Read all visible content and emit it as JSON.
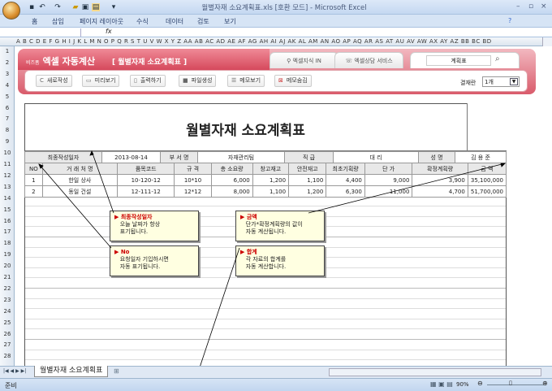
{
  "window": {
    "title": "월별자재 소요계획표.xls  [호환 모드] - Microsoft Excel"
  },
  "ribbon": {
    "tabs": [
      "홈",
      "삽입",
      "페이지 레이아웃",
      "수식",
      "데이터",
      "검토",
      "보기"
    ]
  },
  "formula": {
    "fx": "fx"
  },
  "columns": "A B C D E F G H I J K L M N O P Q R S T U V W X Y Z AA AB AC AD AE AF AG AH AI AJ AK AL AM AN AO AP AQ AR AS AT AU AV AW AX AY AZ BB BC BD",
  "rows": [
    "1",
    "2",
    "3",
    "4",
    "5",
    "6",
    "7",
    "8",
    "9",
    "10",
    "11",
    "12",
    "13",
    "14",
    "15",
    "16",
    "17",
    "18",
    "19",
    "20",
    "21",
    "22",
    "23",
    "24",
    "25",
    "26",
    "27",
    "28"
  ],
  "banner": {
    "brand_small": "비즈폼",
    "brand": "엑셀 자동계산",
    "subtitle": "[ 월별자재 소요계획표 ]",
    "tab1": "엑셀지식 IN",
    "tab2": "엑셀상담 서비스",
    "search_value": "계획표",
    "buttons": [
      "새로작성",
      "미리보기",
      "출력하기",
      "파일생성",
      "메모보기",
      "메모숨김"
    ],
    "approval_label": "결재란",
    "approval_value": "1개"
  },
  "form": {
    "title": "월별자재 소요계획표",
    "info": {
      "date_label": "최종작성일자",
      "date": "2013-08-14",
      "dept_label": "부 서 명",
      "dept": "자재관리팀",
      "rank_label": "직   급",
      "rank": "대   리",
      "name_label": "성   명",
      "name": "김 용 준"
    },
    "headers": [
      "NO",
      "거 래 처 명",
      "품목코드",
      "규   격",
      "총 소요량",
      "창고재고",
      "안전재고",
      "최초기획량",
      "단   가",
      "확정계획량",
      "금   액"
    ],
    "rows": [
      [
        "1",
        "한일 상사",
        "10-120-12",
        "10*10",
        "6,000",
        "1,200",
        "1,100",
        "4,400",
        "9,000",
        "3,900",
        "35,100,000"
      ],
      [
        "2",
        "동일 건설",
        "12-111-12",
        "12*12",
        "8,000",
        "1,100",
        "1,200",
        "6,300",
        "11,000",
        "4,700",
        "51,700,000"
      ]
    ]
  },
  "notes": [
    {
      "title": "최종작성일자",
      "l1": "오늘 날짜가 항상",
      "l2": "표기됩니다."
    },
    {
      "title": "금액",
      "l1": "단가*확정계획량의 값이",
      "l2": "자동 계산됩니다."
    },
    {
      "title": "No",
      "l1": "요청일자 기입하시면",
      "l2": "자동 표기됩니다."
    },
    {
      "title": "합계",
      "l1": "각 자료의 합계를",
      "l2": "자동 계산합니다."
    }
  ],
  "sheet_tab": "월별자재 소요계획표",
  "status": {
    "ready": "준비",
    "zoom": "90%"
  }
}
